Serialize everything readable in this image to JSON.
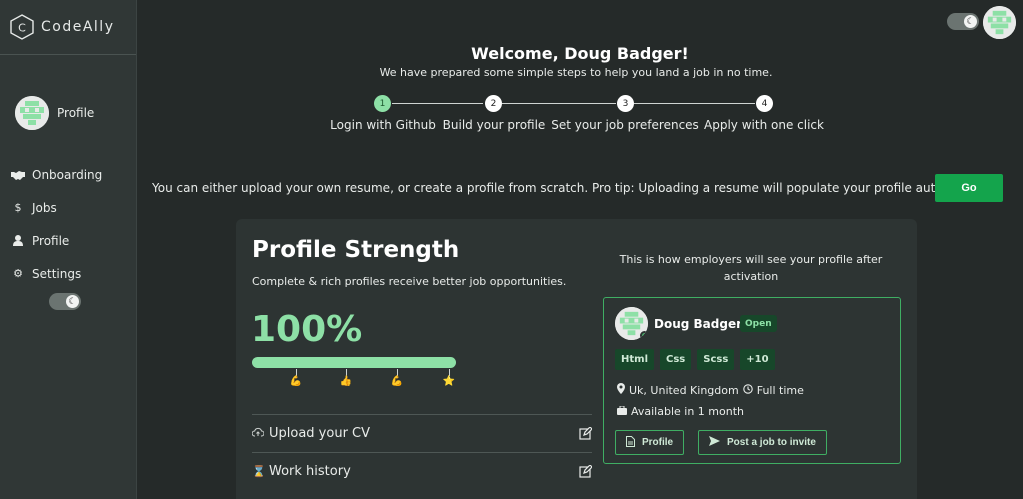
{
  "app": {
    "name": "CodeAlly"
  },
  "sidebar": {
    "profile_label": "Profile",
    "items": [
      {
        "label": "Onboarding",
        "icon": "handshake-icon"
      },
      {
        "label": "Jobs",
        "icon": "dollar-icon"
      },
      {
        "label": "Profile",
        "icon": "user-icon"
      },
      {
        "label": "Settings",
        "icon": "gear-icon"
      }
    ],
    "theme_toggle": "dark"
  },
  "header": {
    "welcome": "Welcome, Doug Badger!",
    "subtitle": "We have prepared some simple steps to help you land a job in no time."
  },
  "steps": [
    {
      "number": "1",
      "label": "Login with Github",
      "active": true
    },
    {
      "number": "2",
      "label": "Build your profile",
      "active": false
    },
    {
      "number": "3",
      "label": "Set your job preferences",
      "active": false
    },
    {
      "number": "4",
      "label": "Apply with one click",
      "active": false
    }
  ],
  "tip": {
    "text": "You can either upload your own resume, or create a profile from scratch. Pro tip: Uploading a resume will populate your profile automagically.",
    "button": "Go"
  },
  "profile_strength": {
    "title": "Profile Strength",
    "subtitle": "Complete & rich profiles receive better job opportunities.",
    "percent_label": "100%",
    "progress": 1.0,
    "milestones": [
      "💪",
      "👍",
      "💪",
      "⭐"
    ],
    "sections": [
      {
        "label": "Upload your CV",
        "icon": "cloud-upload-icon"
      },
      {
        "label": "Work history",
        "icon": "hourglass-icon"
      }
    ]
  },
  "preview": {
    "caption": "This is how employers will see your profile after activation",
    "name": "Doug Badger",
    "status": "Open",
    "skills": [
      "Html",
      "Css",
      "Scss",
      "+10"
    ],
    "location": "Uk, United Kingdom",
    "job_type": "Full time",
    "availability": "Available in 1 month",
    "profile_button": "Profile",
    "invite_button": "Post a job to invite"
  },
  "colors": {
    "accent": "#8de0a6",
    "go_button": "#14a44c",
    "sidebar": "#303736",
    "background": "#252a29"
  }
}
